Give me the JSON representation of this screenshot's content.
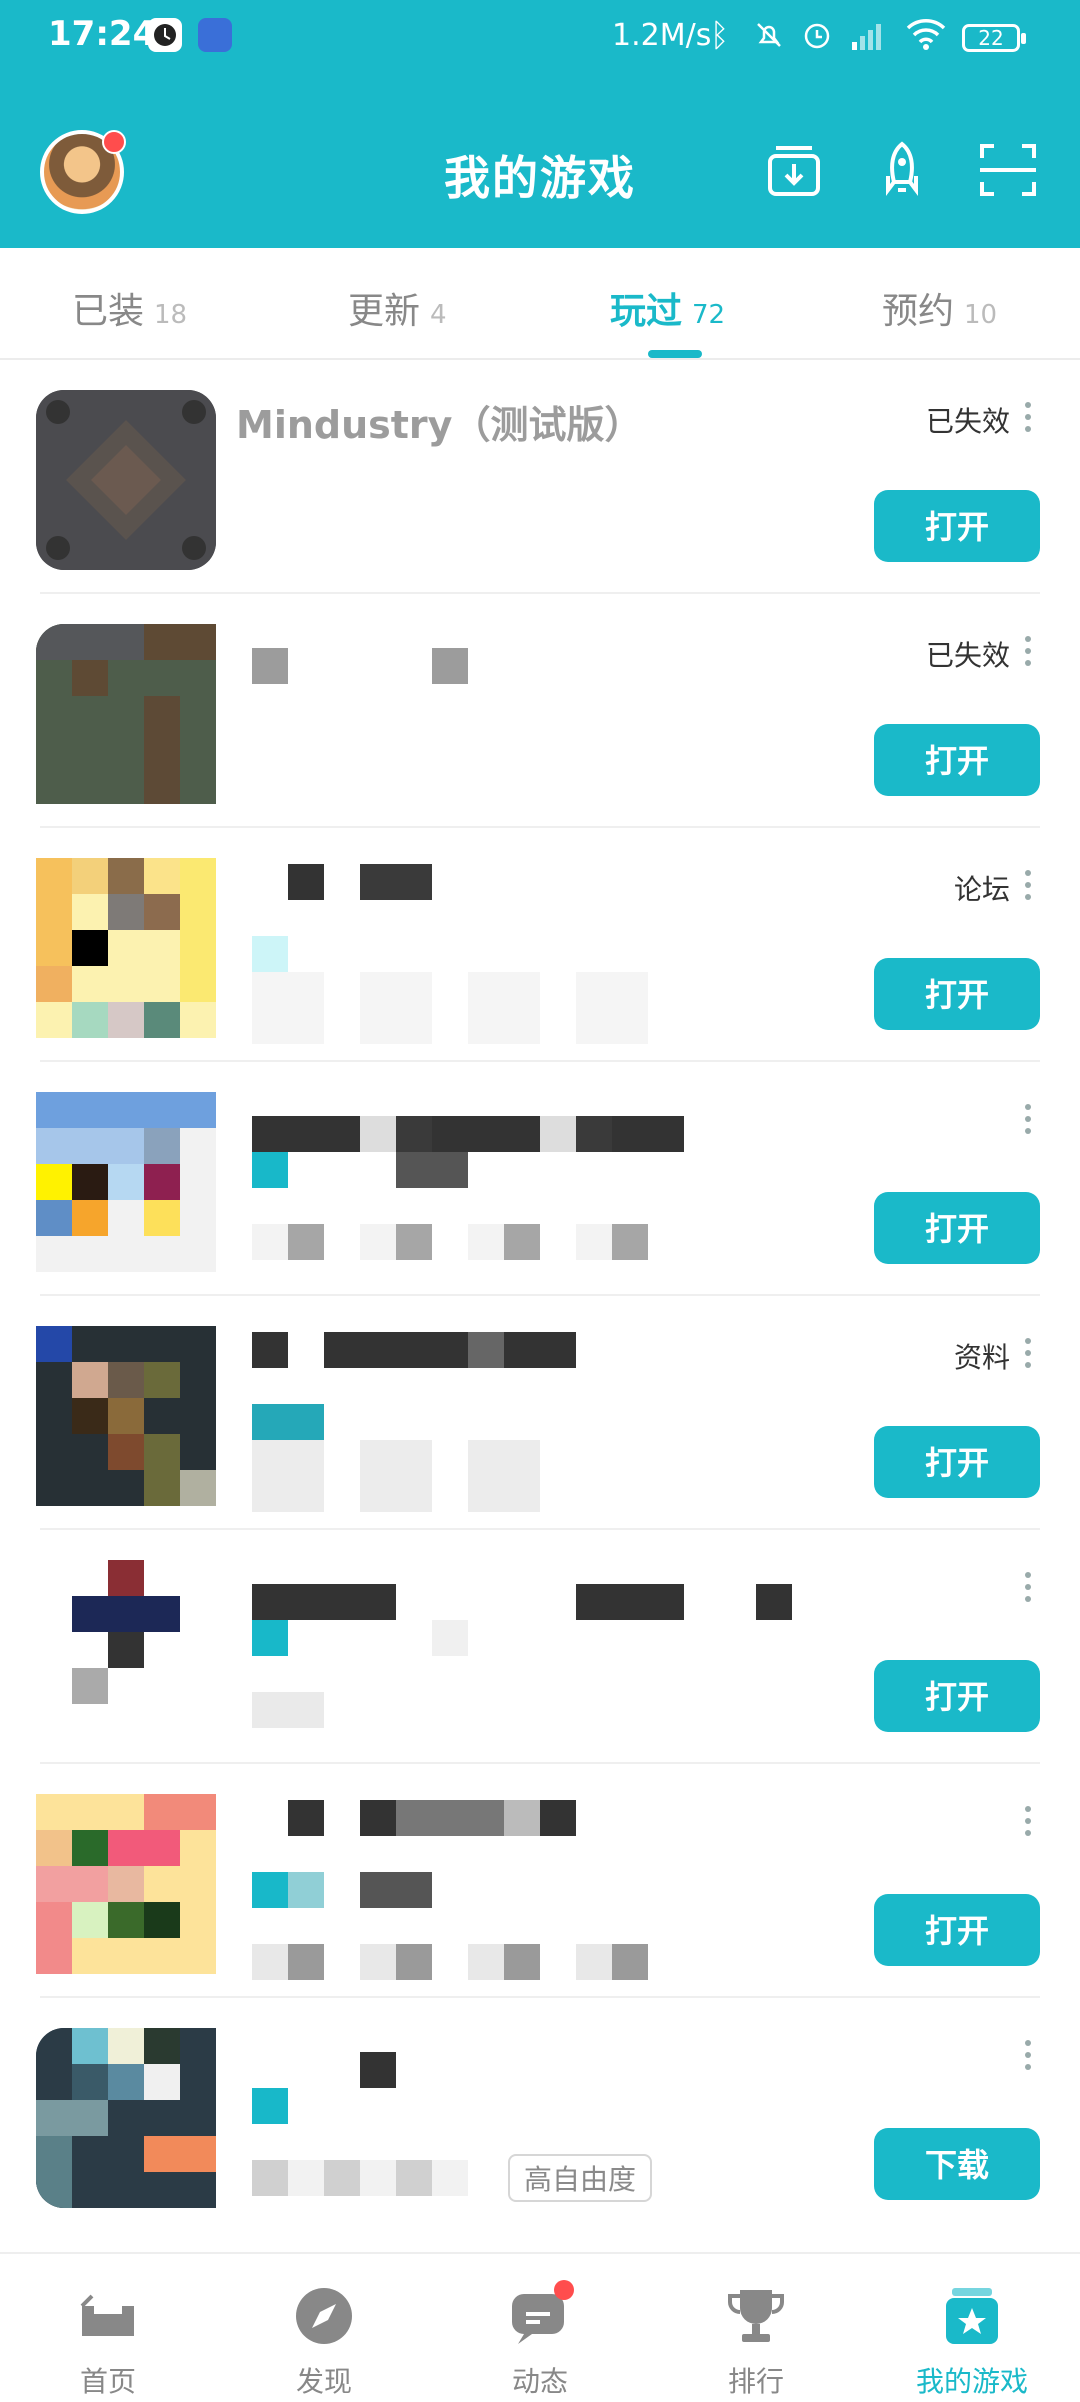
{
  "status_bar": {
    "time": "17:24",
    "speed": "1.2M/s",
    "battery": "22"
  },
  "header": {
    "title": "我的游戏",
    "buttons": [
      "download-icon",
      "rocket-icon",
      "scan-icon"
    ]
  },
  "tabs": [
    {
      "label": "已装",
      "count": "18"
    },
    {
      "label": "更新",
      "count": "4"
    },
    {
      "label": "玩过",
      "count": "72",
      "active": true
    },
    {
      "label": "预约",
      "count": "10"
    }
  ],
  "games": [
    {
      "name": "Mindustry（测试版）",
      "status": "已失效",
      "action": "打开"
    },
    {
      "name": "",
      "status": "已失效",
      "action": "打开"
    },
    {
      "name": "",
      "status": "论坛",
      "action": "打开"
    },
    {
      "name": "",
      "status": "",
      "action": "打开"
    },
    {
      "name": "",
      "status": "资料",
      "action": "打开"
    },
    {
      "name": "",
      "status": "",
      "action": "打开"
    },
    {
      "name": "",
      "status": "",
      "action": "打开"
    },
    {
      "name": "",
      "status": "",
      "action": "下载",
      "tag": "高自由度"
    }
  ],
  "bottom_nav": [
    {
      "label": "首页",
      "icon": "home-icon"
    },
    {
      "label": "发现",
      "icon": "compass-icon"
    },
    {
      "label": "动态",
      "icon": "chat-icon",
      "badge": true
    },
    {
      "label": "排行",
      "icon": "trophy-icon"
    },
    {
      "label": "我的游戏",
      "icon": "game-box-icon",
      "active": true
    }
  ],
  "colors": {
    "accent": "#1ab9c9",
    "badge": "#ff4d4d"
  }
}
